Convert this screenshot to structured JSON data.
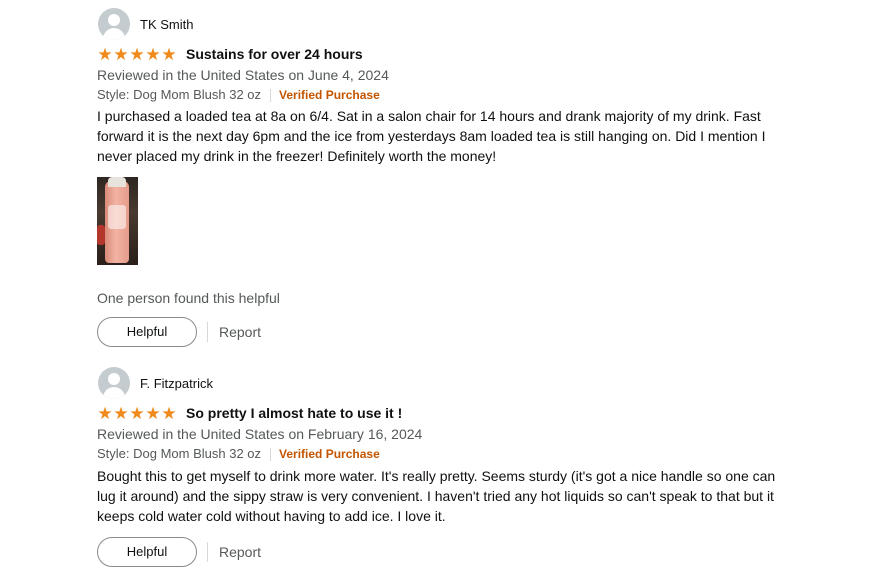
{
  "reviews": [
    {
      "author": "TK Smith",
      "rating": 5,
      "title": "Sustains for over 24 hours",
      "reviewed_in": "Reviewed in the United States on June 4, 2024",
      "style": "Style: Dog Mom Blush 32 oz",
      "verified": "Verified Purchase",
      "body": "I purchased a loaded tea at 8a on 6/4. Sat in a salon chair for 14 hours and drank majority of my drink. Fast forward it is the next day 6pm and the ice from yesterdays 8am loaded tea is still hanging on. Did I mention I never placed my drink in the freezer! Definitely worth the money!",
      "helpful_count": "One person found this helpful",
      "helpful_label": "Helpful",
      "report_label": "Report"
    },
    {
      "author": "F. Fitzpatrick",
      "rating": 5,
      "title": "So pretty I almost hate to use it !",
      "reviewed_in": "Reviewed in the United States on February 16, 2024",
      "style": "Style: Dog Mom Blush 32 oz",
      "verified": "Verified Purchase",
      "body": "Bought this to get myself to drink more water. It's really pretty. Seems sturdy (it's got a nice handle so one can lug it around) and the sippy straw is very convenient. I haven't tried any hot liquids so can't speak to that but it keeps cold water cold without having to add ice. I love it.",
      "helpful_label": "Helpful",
      "report_label": "Report"
    }
  ],
  "colors": {
    "star": "#f08a1c",
    "verified": "#c45500",
    "muted_text": "#565959",
    "text": "#0f1111"
  },
  "icons": {
    "avatar": "default-profile-avatar-icon",
    "star": "star-icon"
  }
}
